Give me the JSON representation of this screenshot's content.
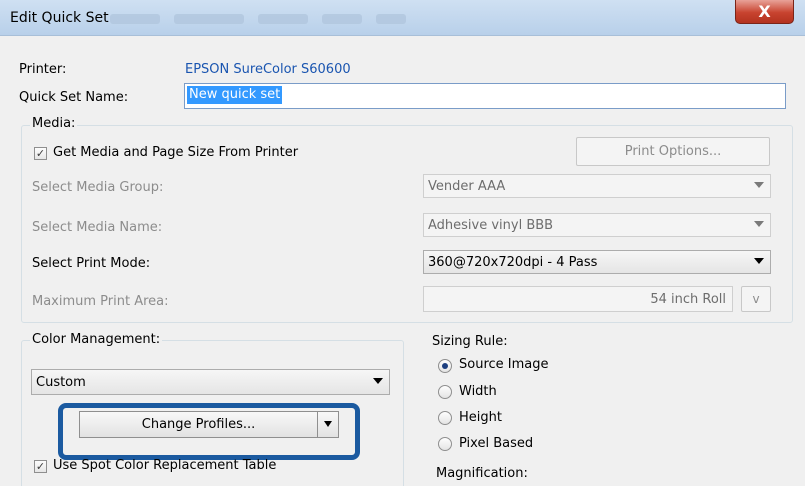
{
  "window": {
    "title": "Edit Quick Set",
    "close_label": "X"
  },
  "printer": {
    "label": "Printer:",
    "value": "EPSON SureColor S60600"
  },
  "quickset": {
    "label": "Quick Set Name:",
    "value": "New quick set"
  },
  "media": {
    "group_label": "Media:",
    "get_media_checkbox": {
      "label": "Get Media and Page Size From Printer",
      "checked": true
    },
    "print_options_label": "Print Options...",
    "media_group": {
      "label": "Select Media Group:",
      "value": "Vender AAA"
    },
    "media_name": {
      "label": "Select Media Name:",
      "value": "Adhesive vinyl BBB"
    },
    "print_mode": {
      "label": "Select Print Mode:",
      "value": "360@720x720dpi - 4 Pass"
    },
    "max_area": {
      "label": "Maximum Print Area:",
      "value": "54 inch Roll",
      "button_label": "v"
    }
  },
  "color_management": {
    "group_label": "Color Management:",
    "mode_value": "Custom",
    "change_profiles_label": "Change Profiles...",
    "spot_color_checkbox": {
      "label": "Use Spot Color Replacement Table",
      "checked": true
    }
  },
  "sizing_rule": {
    "group_label": "Sizing Rule:",
    "options": [
      {
        "label": "Source Image",
        "selected": true
      },
      {
        "label": "Width",
        "selected": false
      },
      {
        "label": "Height",
        "selected": false
      },
      {
        "label": "Pixel Based",
        "selected": false
      }
    ],
    "magnification_label": "Magnification:"
  },
  "colors": {
    "highlight_border": "#1b5aa0",
    "printer_link": "#1a55b0",
    "selection": "#3399ff",
    "close_button": "#c8432f"
  }
}
